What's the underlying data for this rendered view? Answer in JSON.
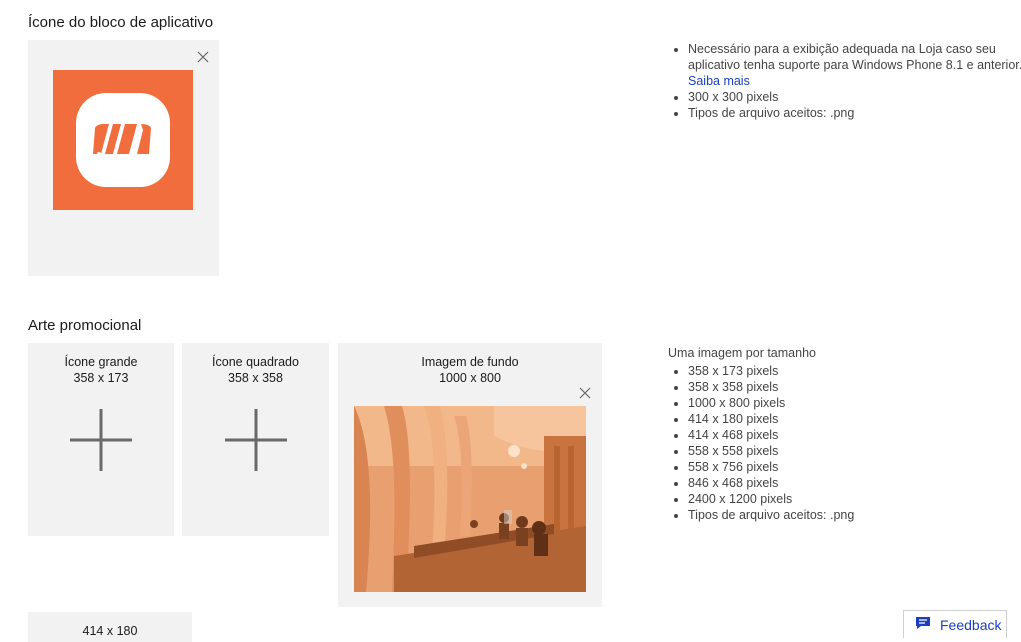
{
  "tile_section": {
    "title": "Ícone do bloco de aplicativo",
    "info": {
      "items": [
        "Necessário para a exibição adequada na Loja caso seu aplicativo tenha suporte para Windows Phone 8.1 e anterior.",
        "300 x 300 pixels",
        "Tipos de arquivo aceitos: .png"
      ],
      "learn_more_label": "Saiba mais"
    },
    "logo_color": "#f26d3d"
  },
  "promo_section": {
    "title": "Arte promocional",
    "slots": [
      {
        "label": "Ícone grande",
        "size": "358 x 173",
        "state": "empty"
      },
      {
        "label": "Ícone quadrado",
        "size": "358 x 358",
        "state": "empty"
      },
      {
        "label": "Imagem de fundo",
        "size": "1000 x 800",
        "state": "uploaded"
      },
      {
        "label": "",
        "size": "414 x 180",
        "state": "empty"
      }
    ],
    "info": {
      "heading": "Uma imagem por tamanho",
      "items": [
        "358 x 173 pixels",
        "358 x 358 pixels",
        "1000 x 800 pixels",
        "414 x 180 pixels",
        "414 x 468 pixels",
        "558 x 558 pixels",
        "558 x 756 pixels",
        "846 x 468 pixels",
        "2400 x 1200 pixels",
        "Tipos de arquivo aceitos: .png"
      ]
    }
  },
  "feedback": {
    "label": "Feedback",
    "icon": "chat-bubble-icon"
  }
}
